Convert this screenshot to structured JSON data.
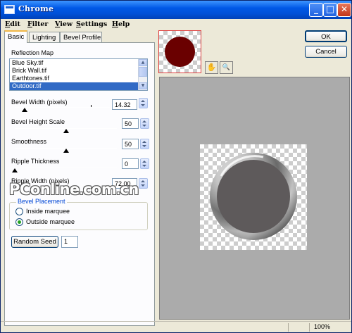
{
  "window": {
    "title": "Chrome",
    "min_glyph": "_",
    "max_glyph": "□",
    "close_glyph": "✕"
  },
  "menu": [
    {
      "mnemonic": "E",
      "rest": "dit"
    },
    {
      "mnemonic": "F",
      "rest": "ilter"
    },
    {
      "mnemonic": "V",
      "rest": "iew"
    },
    {
      "mnemonic": "S",
      "rest": "ettings"
    },
    {
      "mnemonic": "H",
      "rest": "elp"
    }
  ],
  "tabs": [
    "Basic",
    "Lighting",
    "Bevel Profile"
  ],
  "reflection_map": {
    "label": "Reflection Map",
    "items": [
      "Blue Sky.tif",
      "Brick Wall.tif",
      "Earthtones.tif",
      "Outdoor.tif"
    ],
    "selected": "Outdoor.tif"
  },
  "controls": {
    "bevel_width": {
      "label": "Bevel Width (pixels)",
      "value": "14.32"
    },
    "bevel_height_scale": {
      "label": "Bevel Height Scale",
      "value": "50"
    },
    "smoothness": {
      "label": "Smoothness",
      "value": "50"
    },
    "ripple_thickness": {
      "label": "Ripple Thickness",
      "value": "0"
    },
    "ripple_width": {
      "label": "Ripple Width (pixels)",
      "value": "72.00"
    }
  },
  "slider_levels": {
    "bevel_width": 0.1,
    "bevel_height_scale": 0.5,
    "smoothness": 0.5,
    "ripple_thickness": 0.0
  },
  "bevel_placement": {
    "legend": "Bevel Placement",
    "inside_label": "Inside marquee",
    "outside_label": "Outside marquee",
    "selected": "Outside marquee"
  },
  "random_seed": {
    "button_label": "Random Seed",
    "value": "1"
  },
  "buttons": {
    "ok": "OK",
    "cancel": "Cancel"
  },
  "tools": {
    "hand_glyph": "✋",
    "zoom_glyph": "🔍"
  },
  "watermark": {
    "part1": "PC",
    "part2": "online",
    "dot": ".",
    "part3": "com",
    "part4": "cn"
  },
  "status": {
    "zoom": "100%"
  },
  "colors": {
    "thumbnail_fill": "#6a0000",
    "lens_fill": "#5e5a5b",
    "title_accent": "#0050d8",
    "selection": "#316ac5"
  }
}
